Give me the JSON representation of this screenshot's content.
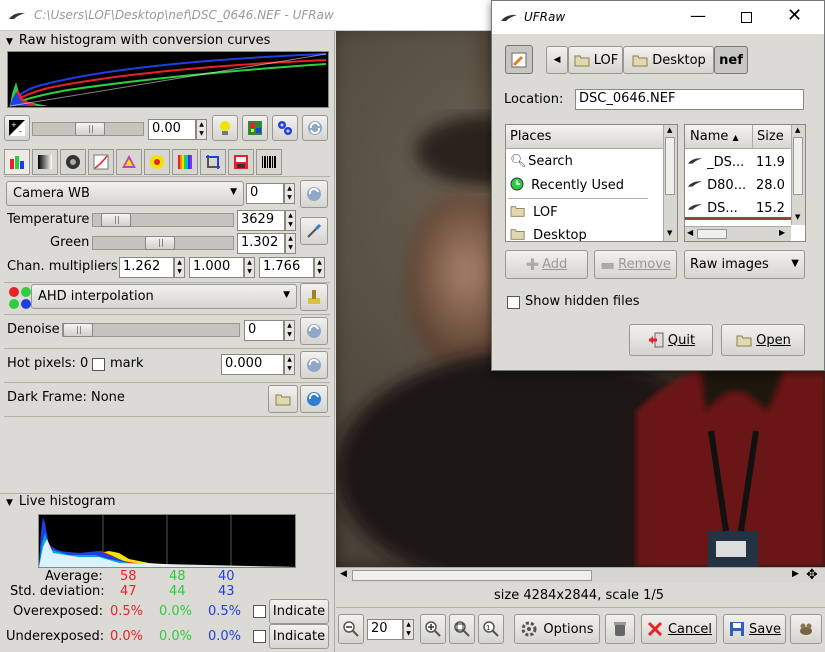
{
  "window": {
    "title": "C:\\Users\\LOF\\Desktop\\nef\\DSC_0646.NEF - UFRaw"
  },
  "raw_histogram": {
    "label": "Raw histogram with conversion curves"
  },
  "exposure": {
    "value": "0.00"
  },
  "whitebalance": {
    "preset": "Camera WB",
    "fine_tune": "0",
    "temperature_label": "Temperature",
    "temperature": "3629",
    "green_label": "Green",
    "green": "1.302",
    "temperature_level": 0.1,
    "green_level": 0.45
  },
  "chan_multipliers": {
    "label": "Chan. multipliers:",
    "r": "1.262",
    "g": "1.000",
    "b": "1.766"
  },
  "interpolation": {
    "value": "AHD interpolation"
  },
  "denoise": {
    "label": "Denoise",
    "value": "0",
    "level": 0.0
  },
  "hot_pixels": {
    "label": "Hot pixels: 0",
    "mark_label": "mark",
    "value": "0.000"
  },
  "dark_frame": {
    "label": "Dark Frame: None"
  },
  "live_histogram": {
    "label": "Live histogram",
    "average_label": "Average:",
    "stddev_label": "Std. deviation:",
    "average": {
      "r": "58",
      "g": "48",
      "b": "40"
    },
    "stddev": {
      "r": "47",
      "g": "44",
      "b": "43"
    },
    "overexposed_label": "Overexposed:",
    "underexposed_label": "Underexposed:",
    "overexposed": {
      "r": "0.5%",
      "g": "0.0%",
      "b": "0.5%"
    },
    "underexposed": {
      "r": "0.0%",
      "g": "0.0%",
      "b": "0.0%"
    },
    "indicate_label": "Indicate"
  },
  "status": {
    "size_text": "size 4284x2844, scale 1/5"
  },
  "toolbar": {
    "zoom": "20",
    "options_label": "Options",
    "cancel_label": "Cancel",
    "save_label": "Save"
  },
  "dialog": {
    "title": "UFRaw",
    "path": [
      "LOF",
      "Desktop",
      "nef"
    ],
    "location_label": "Location:",
    "location_value": "DSC_0646.NEF",
    "places_header": "Places",
    "places": [
      "Search",
      "Recently Used",
      "LOF",
      "Desktop"
    ],
    "files_header_name": "Name",
    "files_header_size": "Size",
    "files": [
      {
        "name": "_DS...",
        "size": "11.9"
      },
      {
        "name": "D80...",
        "size": "28.0"
      },
      {
        "name": "DS...",
        "size": "15.2"
      }
    ],
    "add_label": "Add",
    "remove_label": "Remove",
    "filter": "Raw images",
    "show_hidden_label": "Show hidden files",
    "quit_label": "Quit",
    "open_label": "Open"
  },
  "colors": {
    "red": "#e8212a",
    "green": "#2ecc40",
    "blue": "#1f3fe0",
    "accent": "#2f7fd0"
  }
}
